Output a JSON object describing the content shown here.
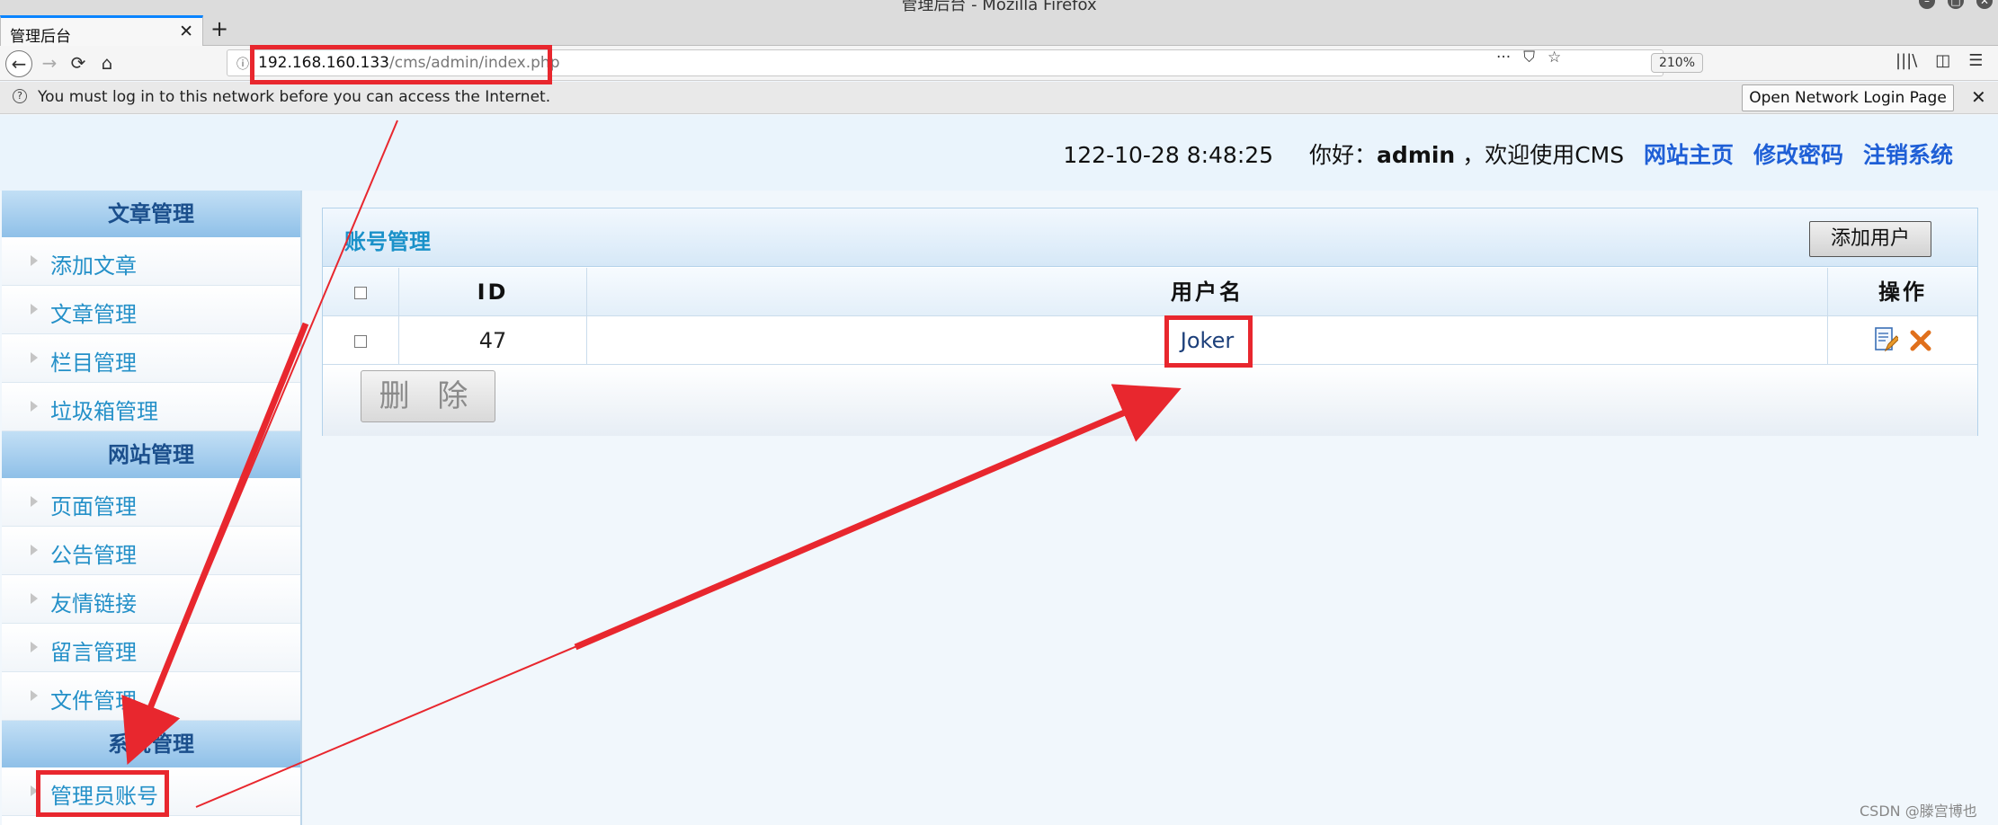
{
  "window": {
    "title": "管理后台 - Mozilla Firefox",
    "controls": [
      "–",
      "□",
      "✕"
    ]
  },
  "tab": {
    "title": "管理后台",
    "close": "✕",
    "new_tab": "+"
  },
  "toolbar": {
    "back": "←",
    "forward": "→",
    "reload": "⟳",
    "home": "⌂",
    "info": "ⓘ",
    "url_host": "192.168.160.133",
    "url_path": "/cms/admin/index.php",
    "zoom": "210%",
    "more": "···",
    "pocket": "⛉",
    "bookmark": "☆",
    "library": "|||\\",
    "sidebar": "◫",
    "menu": "☰"
  },
  "notification": {
    "icon": "?",
    "text": "You must log in to this network before you can access the Internet.",
    "button": "Open Network Login Page",
    "close": "✕"
  },
  "header": {
    "datetime": "122-10-28 8:48:25",
    "greeting_prefix": "你好：",
    "username": "admin",
    "greeting_suffix": "，欢迎使用CMS",
    "links": [
      "网站主页",
      "修改密码",
      "注销系统"
    ]
  },
  "sidebar": {
    "groups": [
      {
        "title": "文章管理",
        "items": [
          "添加文章",
          "文章管理",
          "栏目管理",
          "垃圾箱管理"
        ]
      },
      {
        "title": "网站管理",
        "items": [
          "页面管理",
          "公告管理",
          "友情链接",
          "留言管理",
          "文件管理"
        ]
      },
      {
        "title": "系统管理",
        "items": [
          "管理员账号"
        ]
      }
    ]
  },
  "main": {
    "title": "账号管理",
    "add_button": "添加用户",
    "columns": [
      "",
      "ID",
      "用户名",
      "操作"
    ],
    "rows": [
      {
        "id": "47",
        "username": "Joker"
      }
    ],
    "delete_button": "删 除"
  },
  "watermark": "CSDN @滕宫博也",
  "colors": {
    "accent_link": "#1f5fd6",
    "sidebar_text": "#2490c8",
    "annotation_red": "#e8272e"
  }
}
